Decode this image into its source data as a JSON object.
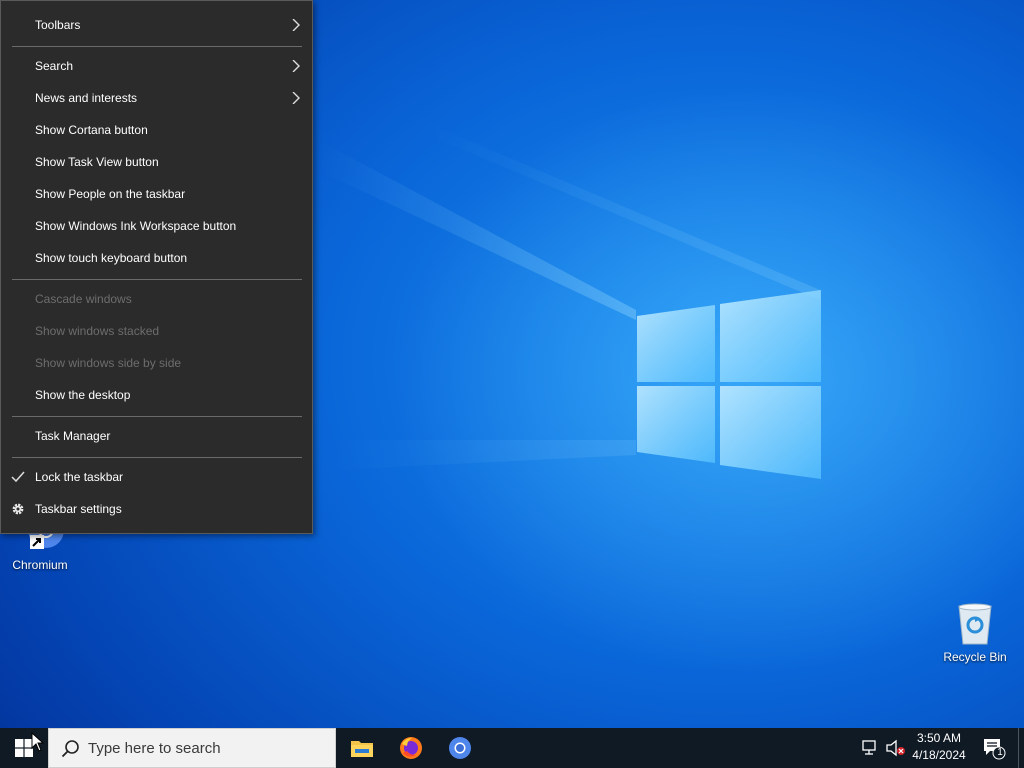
{
  "desktop": {
    "icons": [
      {
        "label": "Chromium"
      },
      {
        "label": "Recycle Bin"
      }
    ]
  },
  "context_menu": {
    "items": [
      {
        "label": "Toolbars",
        "has_submenu": true,
        "enabled": true
      },
      {
        "label": "Search",
        "has_submenu": true,
        "enabled": true
      },
      {
        "label": "News and interests",
        "has_submenu": true,
        "enabled": true
      },
      {
        "label": "Show Cortana button",
        "enabled": true
      },
      {
        "label": "Show Task View button",
        "enabled": true
      },
      {
        "label": "Show People on the taskbar",
        "enabled": true
      },
      {
        "label": "Show Windows Ink Workspace button",
        "enabled": true
      },
      {
        "label": "Show touch keyboard button",
        "enabled": true
      },
      {
        "label": "Cascade windows",
        "enabled": false
      },
      {
        "label": "Show windows stacked",
        "enabled": false
      },
      {
        "label": "Show windows side by side",
        "enabled": false
      },
      {
        "label": "Show the desktop",
        "enabled": true
      },
      {
        "label": "Task Manager",
        "enabled": true
      },
      {
        "label": "Lock the taskbar",
        "enabled": true,
        "checked": true
      },
      {
        "label": "Taskbar settings",
        "enabled": true,
        "icon": "gear-icon"
      }
    ]
  },
  "taskbar": {
    "search_placeholder": "Type here to search",
    "pinned_apps": [
      "file-explorer-icon",
      "firefox-icon",
      "chromium-icon"
    ],
    "clock": {
      "time": "3:50 AM",
      "date": "4/18/2024"
    },
    "notification_count": "1"
  },
  "colors": {
    "menu_bg": "#2b2b2b",
    "menu_disabled_text": "#6d6d6d",
    "taskbar_bg": "#101a24",
    "desktop_blue": "#0a66d8"
  }
}
